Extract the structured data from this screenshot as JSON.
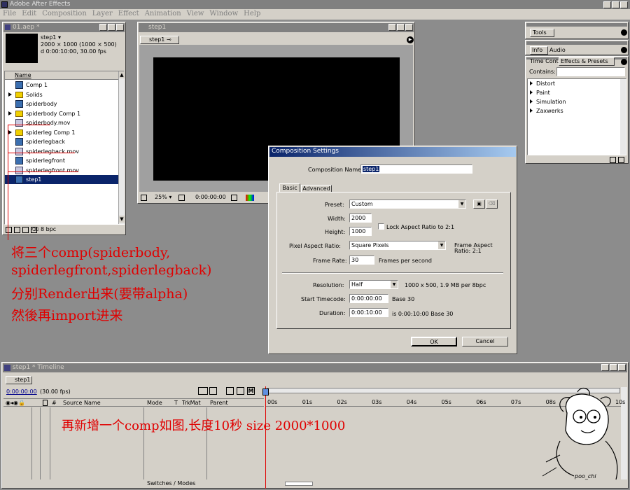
{
  "app": {
    "title": "Adobe After Effects",
    "menu": [
      "File",
      "Edit",
      "Composition",
      "Layer",
      "Effect",
      "Animation",
      "View",
      "Window",
      "Help"
    ]
  },
  "project": {
    "title": "01.aep *",
    "comp_name": "step1 ▾",
    "comp_size": "2000 × 1000  (1000 × 500)",
    "comp_dur": "d 0:00:10:00, 30.00 fps",
    "col_name": "Name",
    "bpc": "8 bpc",
    "items": [
      {
        "name": "Comp 1",
        "type": "comp",
        "expand": false
      },
      {
        "name": "Solids",
        "type": "folder",
        "expand": true
      },
      {
        "name": "spiderbody",
        "type": "comp",
        "expand": false
      },
      {
        "name": "spiderbody Comp 1",
        "type": "folder",
        "expand": true
      },
      {
        "name": "spiderbody.mov",
        "type": "mov",
        "expand": false
      },
      {
        "name": "spiderleg Comp 1",
        "type": "folder",
        "expand": true
      },
      {
        "name": "spiderlegback",
        "type": "comp",
        "expand": false
      },
      {
        "name": "spiderlegback.mov",
        "type": "mov",
        "expand": false
      },
      {
        "name": "spiderlegfront",
        "type": "comp",
        "expand": false
      },
      {
        "name": "spiderlegfront.mov",
        "type": "mov",
        "expand": false
      },
      {
        "name": "step1",
        "type": "comp",
        "expand": false
      }
    ]
  },
  "comp": {
    "title": "step1",
    "tab": "step1 ⊸",
    "zoom": "25% ▾",
    "time": "0:00:00:00"
  },
  "tools": {
    "title": "Tools"
  },
  "info": {
    "tab1": "Info",
    "tab2": "Audio"
  },
  "effects": {
    "tab1": "Time Contr",
    "tab2": "Effects & Presets",
    "contains_label": "Contains:",
    "items": [
      "Distort",
      "Paint",
      "Simulation",
      "Zaxwerks"
    ]
  },
  "dialog": {
    "title": "Composition Settings",
    "name_label": "Composition Name:",
    "name_value": "step1",
    "tab_basic": "Basic",
    "tab_advanced": "Advanced",
    "preset_label": "Preset:",
    "preset_value": "Custom",
    "width_label": "Width:",
    "width_value": "2000",
    "height_label": "Height:",
    "height_value": "1000",
    "lock_label": "Lock Aspect Ratio to 2:1",
    "par_label": "Pixel Aspect Ratio:",
    "par_value": "Square Pixels",
    "frame_aspect_1": "Frame Aspect",
    "frame_aspect_2": "Ratio: 2:1",
    "fps_label": "Frame Rate:",
    "fps_value": "30",
    "fps_unit": "Frames per second",
    "res_label": "Resolution:",
    "res_value": "Half",
    "res_info": "1000 x 500, 1.9 MB per 8bpc",
    "start_label": "Start Timecode:",
    "start_value": "0:00:00:00",
    "start_base": "Base 30",
    "dur_label": "Duration:",
    "dur_value": "0:00:10:00",
    "dur_info": "is 0:00:10:00  Base 30",
    "ok": "OK",
    "cancel": "Cancel"
  },
  "timeline": {
    "title": "step1 * Timeline",
    "tab": "step1",
    "time": "0:00:00:00",
    "fps": "(30.00 fps)",
    "col_source": "Source Name",
    "col_mode": "Mode",
    "col_t": "T",
    "col_trkmat": "TrkMat",
    "col_parent": "Parent",
    "switches": "Switches / Modes",
    "ticks": [
      "00s",
      "01s",
      "02s",
      "03s",
      "04s",
      "05s",
      "06s",
      "07s",
      "08s",
      "09s",
      "10s"
    ]
  },
  "annotations": {
    "line1": "将三个comp(spiderbody,",
    "line2": "spiderlegfront,spiderlegback)",
    "line3": "分别Render出来(要带alpha)",
    "line4": "然後再import进来",
    "timeline_note": "再新增一个comp如图,长度10秒 size 2000*1000"
  },
  "signature": "poo_chi",
  "colors": {
    "annotation": "#e00000",
    "title_active": "#0a246a",
    "workspace": "#8c8c8c"
  }
}
